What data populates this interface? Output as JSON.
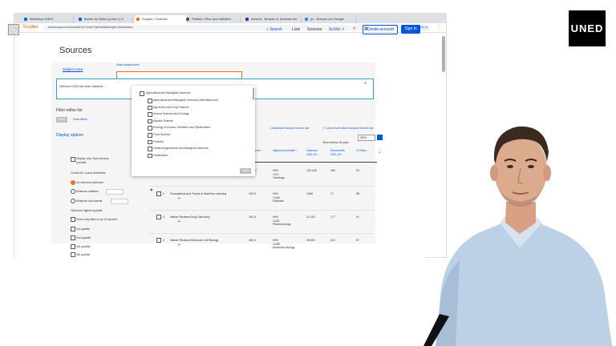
{
  "browser": {
    "tabs": [
      {
        "label": "Biblioteca UNED",
        "color": "#1565c0"
      },
      {
        "label": "Bases de Datos (jr-intp 1)-0",
        "color": "#1565c0"
      },
      {
        "label": "Scopus • Sources",
        "color": "#e9711c"
      },
      {
        "label": "Publish • Plan and statistics",
        "color": "#6d4c41"
      },
      {
        "label": "Inicio/A - Browse or Increase the",
        "color": "#6a1b9a"
      },
      {
        "label": "jcr - Buscar con Google",
        "color": "#4285f4"
      }
    ],
    "url": "www.scopus.com/sources.uri?zone=TopNavBar&origin=searchbasic",
    "profile": "Verifica que eres tú"
  },
  "scopus": {
    "logo": "Scopus",
    "nav": {
      "search": "Search",
      "lists": "Lists",
      "sources": "Sources",
      "scival": "SciVal ↗"
    },
    "create_account": "Create account",
    "sign_in": "Sign in",
    "page_title": "Sources"
  },
  "search": {
    "subject_area": "Subject area",
    "enter_subject_placeholder": "Enter subject area"
  },
  "banner": {
    "text": "CiteScore 2024 has been released..."
  },
  "filters": {
    "title": "Filter refine list",
    "apply": "Apply",
    "clear": "Clear filters",
    "display_options": "Display options",
    "open_access": "Display only Open Access journals",
    "counts_label": "Counts for 4-year timeframe",
    "radios": [
      "No minimum selected",
      "Minimum citations",
      "Minimum documents"
    ],
    "quartile_label": "Citescore highest quartile",
    "top10": "Show only titles in top 10 percent",
    "quartiles": [
      "1st quartile",
      "2nd quartile",
      "3rd quartile",
      "4th quartile"
    ]
  },
  "dropdown": {
    "group": "Agricultural and Biological Sciences",
    "items": [
      "Agricultural and Biological Sciences (miscellaneous)",
      "Agronomy and Crop Science",
      "Animal Science and Zoology",
      "Aquatic Science",
      "Ecology, Evolution, Behavior and Systematics",
      "Food Science",
      "Forestry",
      "General Agricultural and Biological Sciences",
      "Horticulture"
    ],
    "apply": "Apply"
  },
  "table": {
    "download": "Download Scopus Source List",
    "learn_more": "Learn more about Scopus Source List",
    "view_metrics": "View metrics for year:",
    "year": "2024",
    "headers": {
      "citescore": "core ↓",
      "percentile": "Highest percentile ↓",
      "citations": "Citations 2021-24 ↓",
      "documents": "Documents 2021-24 ↓",
      "cited": "% Cited ↓"
    },
    "rows": [
      {
        "num": "1",
        "title": "",
        "score": "",
        "pct": "99%",
        "rank": "1/XX",
        "field": "Oncology",
        "citations": "120,165",
        "docs": "165",
        "cited": "94"
      },
      {
        "num": "2",
        "title": "Foundations and Trends in Machine Learning",
        "score": "182.8",
        "pct": "99%",
        "rank": "1/446",
        "field": "Software",
        "citations": "3458",
        "docs": "17",
        "cited": "88"
      },
      {
        "num": "3",
        "title": "Nature Reviews Drug Discovery",
        "score": "181.8",
        "pct": "99%",
        "rank": "1/321",
        "field": "Pharmacology",
        "citations": "31,163",
        "docs": "177",
        "cited": "91"
      },
      {
        "num": "4",
        "title": "Nature Reviews Molecular Cell Biology",
        "score": "164.9",
        "pct": "99%",
        "rank": "1/408",
        "field": "Molecular Biology",
        "citations": "36,609",
        "docs": "222",
        "cited": "87"
      }
    ]
  },
  "brand": {
    "uned": "UNED"
  }
}
